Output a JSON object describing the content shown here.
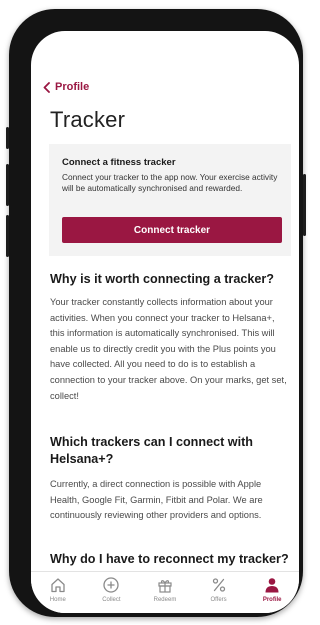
{
  "nav": {
    "back_label": "Profile"
  },
  "page": {
    "title": "Tracker"
  },
  "connect_card": {
    "title": "Connect a fitness tracker",
    "text": "Connect your tracker to the app now. Your exercise activity will be automatically synchronised and rewarded.",
    "button_label": "Connect tracker"
  },
  "sections": [
    {
      "heading": "Why is it worth connecting a tracker?",
      "body": "Your tracker constantly collects information about your activities. When you connect your tracker to Helsana+, this information is automatically synchronised. This will enable us to directly credit you with the Plus points you have collected. All you need to do is to establish a connection to your tracker above. On your marks, get set, collect!"
    },
    {
      "heading": "Which trackers can I connect with Helsana+?",
      "body": "Currently, a direct connection is possible with Apple Health, Google Fit, Garmin, Fitbit and Polar. We are continuously reviewing other providers and options."
    },
    {
      "heading": "Why do I have to reconnect my tracker?"
    }
  ],
  "tabbar": {
    "items": [
      {
        "label": "Home",
        "icon": "house-icon"
      },
      {
        "label": "Collect",
        "icon": "plus-circle-icon"
      },
      {
        "label": "Redeem",
        "icon": "gift-icon"
      },
      {
        "label": "Offers",
        "icon": "percent-icon"
      },
      {
        "label": "Profile",
        "icon": "person-icon"
      }
    ],
    "active": "Profile"
  },
  "colors": {
    "accent": "#9a1742",
    "card_bg": "#f3f3f3",
    "inactive_icon": "#8a8a8a",
    "frame": "#141414"
  }
}
